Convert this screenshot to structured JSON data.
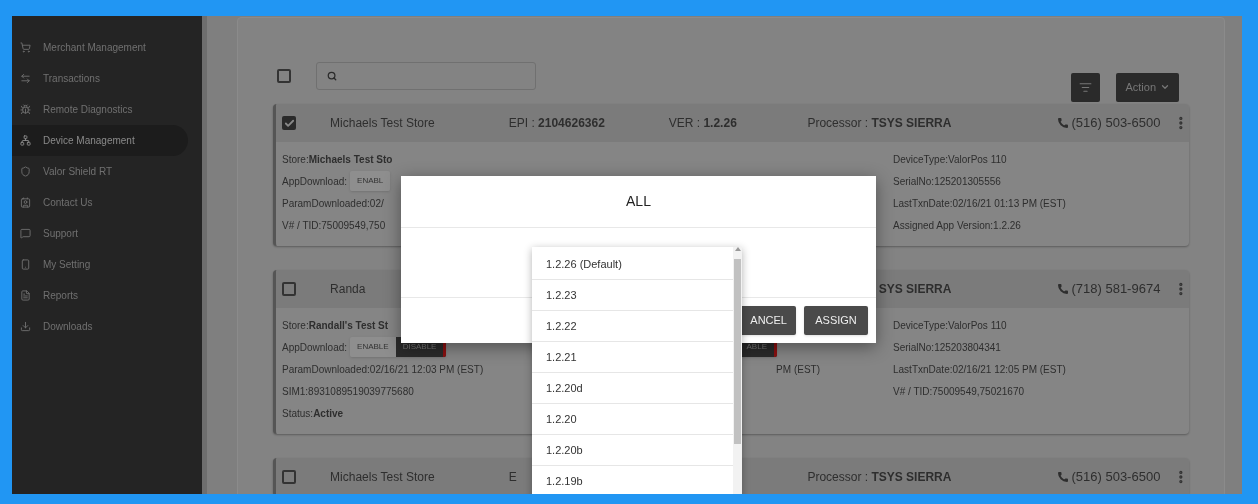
{
  "sidebar": {
    "items": [
      {
        "label": "Merchant Management",
        "selected": false
      },
      {
        "label": "Transactions",
        "selected": false
      },
      {
        "label": "Remote Diagnostics",
        "selected": false
      },
      {
        "label": "Device Management",
        "selected": true
      },
      {
        "label": "Valor Shield RT",
        "selected": false
      },
      {
        "label": "Contact Us",
        "selected": false
      },
      {
        "label": "Support",
        "selected": false
      },
      {
        "label": "My Setting",
        "selected": false
      },
      {
        "label": "Reports",
        "selected": false
      },
      {
        "label": "Downloads",
        "selected": false
      }
    ]
  },
  "toolbar": {
    "select_all": {
      "checked": false
    },
    "action_button": "Action"
  },
  "cards": [
    {
      "checked": true,
      "header": {
        "name": "Michaels Test Store",
        "epi_label": "EPI : ",
        "epi": "2104626362",
        "ver_label": "VER : ",
        "ver": "1.2.26",
        "processor_label": "Processor : ",
        "processor": "TSYS SIERRA",
        "phone": "(516) 503-6500"
      },
      "rows": [
        {
          "left": {
            "kind": "text",
            "text": "Store:**Michaels Test Sto**"
          },
          "right": {
            "kind": "text",
            "text": "DeviceType:ValorPos 110"
          }
        },
        {
          "left": {
            "kind": "toggle",
            "label": "AppDownload:",
            "enable": "ENABL"
          },
          "right": {
            "kind": "text",
            "text": "SerialNo:125201305556"
          }
        },
        {
          "left": {
            "kind": "text",
            "text": "ParamDownloaded:02/"
          },
          "right": {
            "kind": "text",
            "text": "LastTxnDate:02/16/21 01:13 PM (EST)"
          }
        },
        {
          "left": {
            "kind": "text",
            "text": "V# / TID:75009549,750"
          },
          "right": {
            "kind": "text",
            "text": "Assigned App Version:1.2.26"
          }
        }
      ]
    },
    {
      "checked": false,
      "header": {
        "name": "Randa",
        "processor": "SYS SIERRA",
        "phone": "(718) 581-9674"
      },
      "rows": [
        {
          "left": {
            "kind": "text",
            "text": "Store:**Randall's Test St**"
          },
          "right": {
            "kind": "text",
            "text": "DeviceType:ValorPos 110"
          }
        },
        {
          "left": {
            "kind": "toggle",
            "label": "AppDownload:",
            "enable": "ENABLE",
            "disable": "DISABLE",
            "enabled": false
          },
          "middle": {
            "kind": "toggle",
            "disable": "ABLE",
            "enabled": false
          },
          "right": {
            "kind": "text",
            "text": "SerialNo:125203804341"
          }
        },
        {
          "left": {
            "kind": "text",
            "text": "ParamDownloaded:02/16/21 12:03 PM (EST)"
          },
          "middle": {
            "kind": "text",
            "text": "PM (EST)"
          },
          "right": {
            "kind": "text",
            "text": "LastTxnDate:02/16/21 12:05 PM (EST)"
          }
        },
        {
          "left": {
            "kind": "text",
            "text": "SIM1:8931089519039775680"
          },
          "right": {
            "kind": "text",
            "text": "V# / TID:75009549,75021670"
          }
        },
        {
          "left": {
            "kind": "text",
            "text": "Status:**Active**"
          }
        }
      ]
    },
    {
      "checked": false,
      "header": {
        "name": "Michaels Test Store",
        "epi_label": "E",
        "processor_label": "Processor : ",
        "processor": "TSYS SIERRA",
        "phone": "(516) 503-6500"
      }
    }
  ],
  "dialog": {
    "title": "ALL",
    "cancel_button": "ANCEL",
    "assign_button": "ASSIGN"
  },
  "dropdown": {
    "options": [
      {
        "label": "1.2.26 (Default)",
        "selected": false
      },
      {
        "label": "1.2.23",
        "selected": false
      },
      {
        "label": "1.2.22",
        "selected": false
      },
      {
        "label": "1.2.21",
        "selected": false
      },
      {
        "label": "1.2.20d",
        "selected": false
      },
      {
        "label": "1.2.20",
        "selected": false
      },
      {
        "label": "1.2.20b",
        "selected": false
      },
      {
        "label": "1.2.19b",
        "selected": false
      }
    ]
  }
}
